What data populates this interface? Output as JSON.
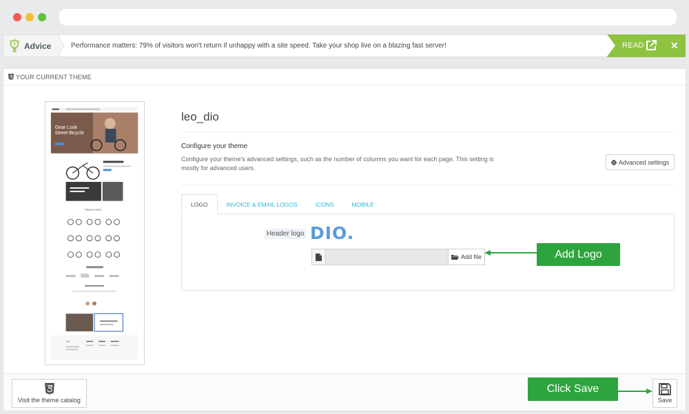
{
  "advice": {
    "label": "Advice",
    "text": "Performance matters: 79% of visitors won't return if unhappy with a site speed. Take your shop live on a blazing fast server!",
    "read_label": "READ",
    "close_label": "✕",
    "accent_color": "#8dc341"
  },
  "panel": {
    "title": "YOUR CURRENT THEME"
  },
  "preview": {
    "hero_line1": "Gear Look",
    "hero_line2": "Street Bicycle",
    "section_title": "Popular in store",
    "footer_logo": "Dio"
  },
  "theme": {
    "name": "leo_dio",
    "config_title": "Configure your theme",
    "config_desc": "Configure your theme's advanced settings, such as the number of columns you want for each page. This setting is mostly for advanced users.",
    "advanced_settings_label": "Advanced settings"
  },
  "tabs": [
    {
      "label": "LOGO",
      "active": true
    },
    {
      "label": "INVOICE & EMAIL LOGOS",
      "active": false
    },
    {
      "label": "ICONS",
      "active": false
    },
    {
      "label": "MOBILE",
      "active": false
    }
  ],
  "logo_tab": {
    "header_logo_label": "Header logo",
    "logo_text": "DIO.",
    "add_file_label": "Add file"
  },
  "annotations": {
    "add_logo": "Add Logo",
    "click_save": "Click Save",
    "color": "#2ea43e"
  },
  "footer": {
    "catalog_label": "Visit the theme catalog",
    "save_label": "Save"
  }
}
